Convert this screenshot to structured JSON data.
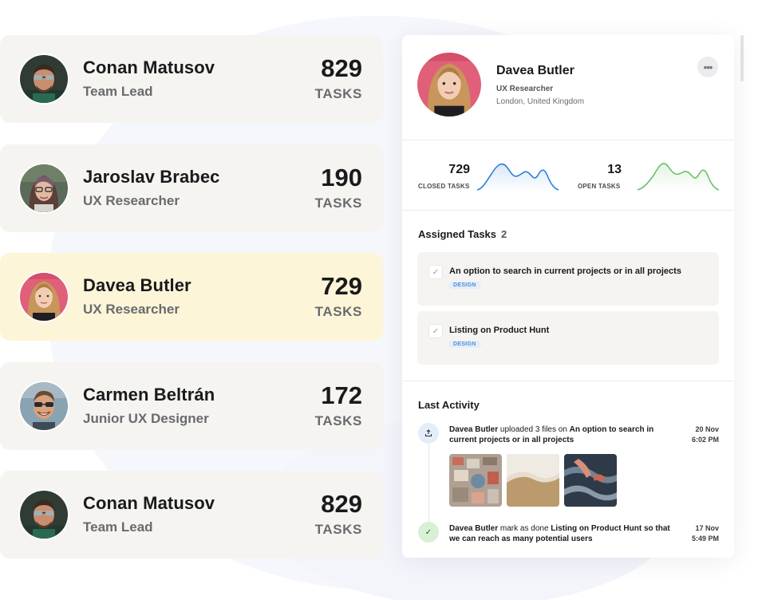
{
  "people": [
    {
      "name": "Conan Matusov",
      "role": "Team Lead",
      "count": "829",
      "unit": "TASKS",
      "active": false
    },
    {
      "name": "Jaroslav Brabec",
      "role": "UX Researcher",
      "count": "190",
      "unit": "TASKS",
      "active": false
    },
    {
      "name": "Davea Butler",
      "role": "UX Researcher",
      "count": "729",
      "unit": "TASKS",
      "active": true
    },
    {
      "name": "Carmen Beltrán",
      "role": "Junior UX Designer",
      "count": "172",
      "unit": "TASKS",
      "active": false
    },
    {
      "name": "Conan Matusov",
      "role": "Team Lead",
      "count": "829",
      "unit": "TASKS",
      "active": false
    }
  ],
  "profile": {
    "name": "Davea Butler",
    "role": "UX Researcher",
    "location": "London, United Kingdom",
    "more_icon": "more-horizontal-icon"
  },
  "stats": {
    "closed": {
      "value": "729",
      "label": "CLOSED TASKS",
      "color": "#2d7fd6"
    },
    "open": {
      "value": "13",
      "label": "OPEN TASKS",
      "color": "#6cc069"
    }
  },
  "assigned": {
    "title": "Assigned Tasks",
    "count": "2",
    "tasks": [
      {
        "title": "An option to search in current projects or in all projects",
        "tag": "DESIGN"
      },
      {
        "title": "Listing on Product Hunt",
        "tag": "DESIGN"
      }
    ]
  },
  "activity": {
    "title": "Last Activity",
    "items": [
      {
        "actor": "Davea Butler",
        "verb": " uploaded 3 files on ",
        "target": "An option to search in current projects or in all projects",
        "date": "20 Nov",
        "time": "6:02 PM",
        "icon": "upload-icon"
      },
      {
        "actor": "Davea Butler",
        "verb": " mark as done ",
        "target": "Listing on Product Hunt so that we can reach as many potential users",
        "date": "17 Nov",
        "time": "5:49 PM",
        "icon": "check-icon"
      }
    ]
  },
  "colors": {
    "card_bg": "#f5f4f1",
    "card_active_bg": "#fdf5d8",
    "tag_text": "#4f8fd8",
    "tag_bg": "#e3eefa"
  }
}
